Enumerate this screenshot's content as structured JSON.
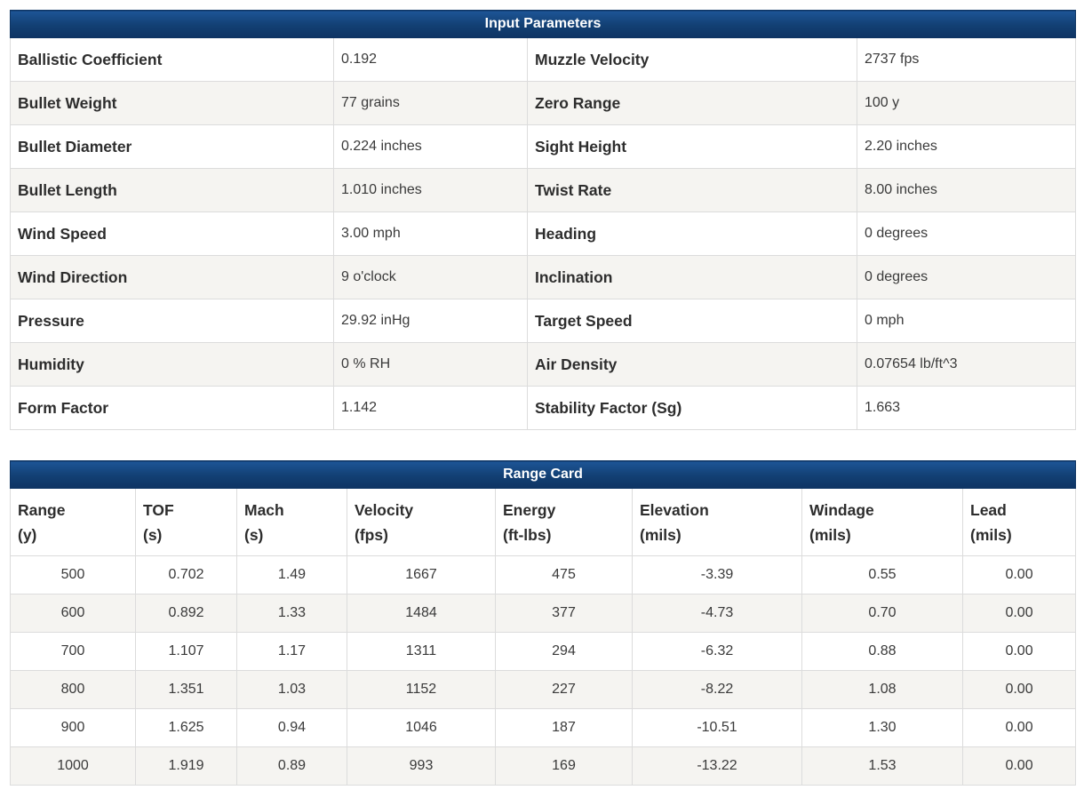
{
  "input_parameters": {
    "title": "Input Parameters",
    "rows": [
      {
        "left_label": "Ballistic Coefficient",
        "left_value": "0.192",
        "right_label": "Muzzle Velocity",
        "right_value": "2737 fps"
      },
      {
        "left_label": "Bullet Weight",
        "left_value": "77 grains",
        "right_label": "Zero Range",
        "right_value": "100 y"
      },
      {
        "left_label": "Bullet Diameter",
        "left_value": "0.224 inches",
        "right_label": "Sight Height",
        "right_value": "2.20 inches"
      },
      {
        "left_label": "Bullet Length",
        "left_value": "1.010 inches",
        "right_label": "Twist Rate",
        "right_value": "8.00 inches"
      },
      {
        "left_label": "Wind Speed",
        "left_value": "3.00 mph",
        "right_label": "Heading",
        "right_value": "0 degrees"
      },
      {
        "left_label": "Wind Direction",
        "left_value": "9 o'clock",
        "right_label": "Inclination",
        "right_value": "0 degrees"
      },
      {
        "left_label": "Pressure",
        "left_value": "29.92 inHg",
        "right_label": "Target Speed",
        "right_value": "0 mph"
      },
      {
        "left_label": "Humidity",
        "left_value": "0 % RH",
        "right_label": "Air Density",
        "right_value": "0.07654 lb/ft^3"
      },
      {
        "left_label": "Form Factor",
        "left_value": "1.142",
        "right_label": "Stability Factor (Sg)",
        "right_value": "1.663"
      }
    ]
  },
  "range_card": {
    "title": "Range Card",
    "columns": [
      {
        "name": "Range",
        "unit": "(y)"
      },
      {
        "name": "TOF",
        "unit": "(s)"
      },
      {
        "name": "Mach",
        "unit": "(s)"
      },
      {
        "name": "Velocity",
        "unit": "(fps)"
      },
      {
        "name": "Energy",
        "unit": "(ft-lbs)"
      },
      {
        "name": "Elevation",
        "unit": "(mils)"
      },
      {
        "name": "Windage",
        "unit": "(mils)"
      },
      {
        "name": "Lead",
        "unit": "(mils)"
      }
    ],
    "rows": [
      [
        "500",
        "0.702",
        "1.49",
        "1667",
        "475",
        "-3.39",
        "0.55",
        "0.00"
      ],
      [
        "600",
        "0.892",
        "1.33",
        "1484",
        "377",
        "-4.73",
        "0.70",
        "0.00"
      ],
      [
        "700",
        "1.107",
        "1.17",
        "1311",
        "294",
        "-6.32",
        "0.88",
        "0.00"
      ],
      [
        "800",
        "1.351",
        "1.03",
        "1152",
        "227",
        "-8.22",
        "1.08",
        "0.00"
      ],
      [
        "900",
        "1.625",
        "0.94",
        "1046",
        "187",
        "-10.51",
        "1.30",
        "0.00"
      ],
      [
        "1000",
        "1.919",
        "0.89",
        "993",
        "169",
        "-13.22",
        "1.53",
        "0.00"
      ]
    ]
  },
  "colors": {
    "header_bar": "#123f73",
    "header_text": "#ffffff",
    "stripe": "#f5f4f1",
    "border": "#dcdcdc"
  }
}
